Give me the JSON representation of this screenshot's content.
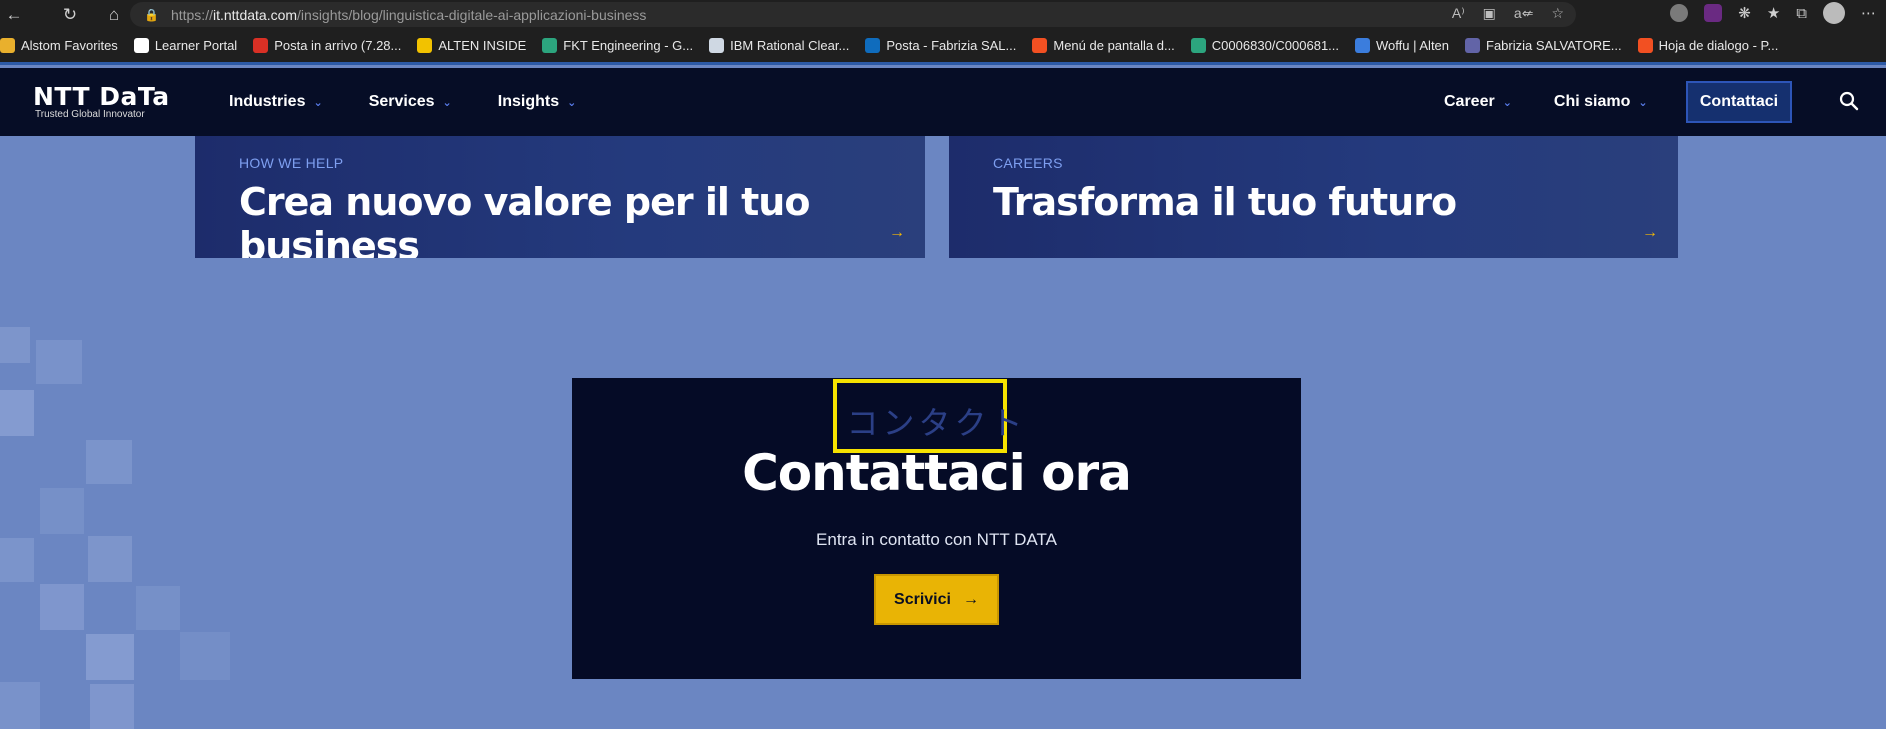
{
  "browser": {
    "url_prefix": "https://",
    "url_domain": "it.nttdata.com",
    "url_path": "/insights/blog/linguistica-digitale-ai-applicazioni-business",
    "bookmarks": [
      {
        "label": "Alstom Favorites",
        "color": "#e9b02d"
      },
      {
        "label": "Learner Portal",
        "color": "#ffffff"
      },
      {
        "label": "Posta in arrivo (7.28...",
        "color": "#d93025"
      },
      {
        "label": "ALTEN INSIDE",
        "color": "#f2c200"
      },
      {
        "label": "FKT Engineering - G...",
        "color": "#2ca57e"
      },
      {
        "label": "IBM Rational Clear...",
        "color": "#cfd8e3"
      },
      {
        "label": "Posta - Fabrizia SAL...",
        "color": "#0f6cbd"
      },
      {
        "label": "Menú de pantalla d...",
        "color": "#f25022"
      },
      {
        "label": "C0006830/C000681...",
        "color": "#2ca57e"
      },
      {
        "label": "Woffu | Alten",
        "color": "#3b7ddd"
      },
      {
        "label": "Fabrizia SALVATORE...",
        "color": "#6264a7"
      },
      {
        "label": "Hoja de dialogo - P...",
        "color": "#f25022"
      }
    ]
  },
  "header": {
    "logo": "NTT DaTa",
    "tagline": "Trusted Global Innovator",
    "nav_left": [
      "Industries",
      "Services",
      "Insights"
    ],
    "nav_right": [
      "Career",
      "Chi siamo"
    ],
    "cta": "Contattaci"
  },
  "cards": [
    {
      "eyebrow": "HOW WE HELP",
      "title": "Crea nuovo valore per il tuo business"
    },
    {
      "eyebrow": "CAREERS",
      "title": "Trasforma il tuo futuro"
    }
  ],
  "contact": {
    "kana": "コンタクト",
    "title": "Contattaci ora",
    "subtitle": "Entra in contatto con NTT DATA",
    "button": "Scrivici"
  },
  "colors": {
    "page_bg": "#6b86c2",
    "header_bg": "#060d26",
    "accent_yellow": "#e9b405",
    "highlight": "#f6e200"
  }
}
